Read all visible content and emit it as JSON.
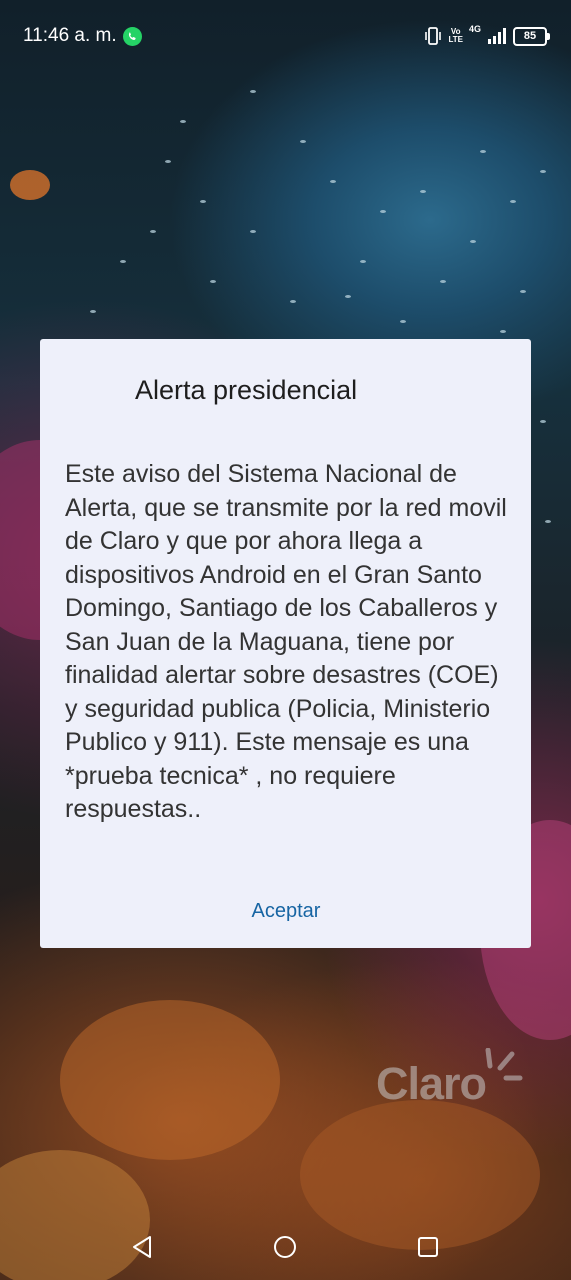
{
  "status_bar": {
    "time": "11:46 a. m.",
    "notification_icons": [
      "whatsapp-icon"
    ],
    "system_icons": [
      "vibrate-icon",
      "volte-icon",
      "4g-icon",
      "signal-icon",
      "battery-icon"
    ],
    "volte_line1": "Vo",
    "volte_line2": "LTE",
    "network_type": "4G",
    "battery_level": "85"
  },
  "dialog": {
    "title": "Alerta presidencial",
    "message": "Este aviso del Sistema Nacional de Alerta, que se transmite por la red movil de Claro y que por ahora llega a dispositivos Android en el Gran Santo Domingo, Santiago de los Caballeros y San Juan de la Maguana, tiene por finalidad alertar sobre desastres (COE) y seguridad publica (Policia, Ministerio Publico y 911). Este mensaje es una *prueba tecnica* , no requiere respuestas..",
    "accept_label": "Aceptar"
  },
  "wallpaper": {
    "brand_logo": "Claro"
  },
  "nav_bar": {
    "buttons": [
      "back-icon",
      "home-icon",
      "recents-icon"
    ]
  },
  "colors": {
    "dialog_background": "#eef0fa",
    "accent": "#1765a3",
    "whatsapp": "#25d366"
  }
}
